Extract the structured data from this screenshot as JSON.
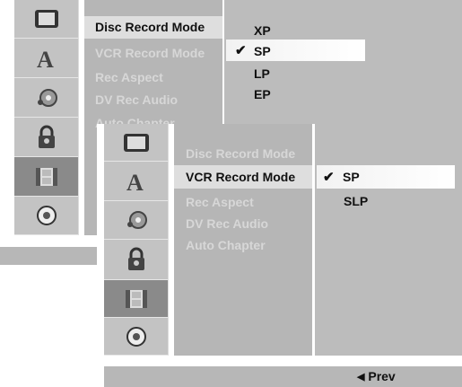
{
  "back_panel": {
    "icons": [
      "monitor-icon",
      "letter-a-icon",
      "disc-record-icon",
      "padlock-icon",
      "film-icon",
      "disc-icon"
    ],
    "selected_icon_index": 4,
    "menu_items": [
      "Disc Record Mode",
      "VCR Record Mode",
      "Rec Aspect",
      "DV Rec Audio",
      "Auto Chapter"
    ],
    "active_menu_index": 0,
    "options": [
      "XP",
      "SP",
      "LP",
      "EP"
    ],
    "checked_option": "SP",
    "highlighted_option_index": 1
  },
  "front_panel": {
    "icons": [
      "monitor-icon",
      "letter-a-icon",
      "disc-record-icon",
      "padlock-icon",
      "film-icon",
      "disc-icon"
    ],
    "selected_icon_index": 4,
    "menu_items": [
      "Disc Record Mode",
      "VCR Record Mode",
      "Rec Aspect",
      "DV Rec Audio",
      "Auto Chapter"
    ],
    "active_menu_index": 1,
    "options": [
      "SP",
      "SLP"
    ],
    "checked_option": "SP",
    "highlighted_option_index": 0,
    "prev_label": "Prev",
    "prev_arrow": "◀"
  },
  "check_mark": "✔"
}
